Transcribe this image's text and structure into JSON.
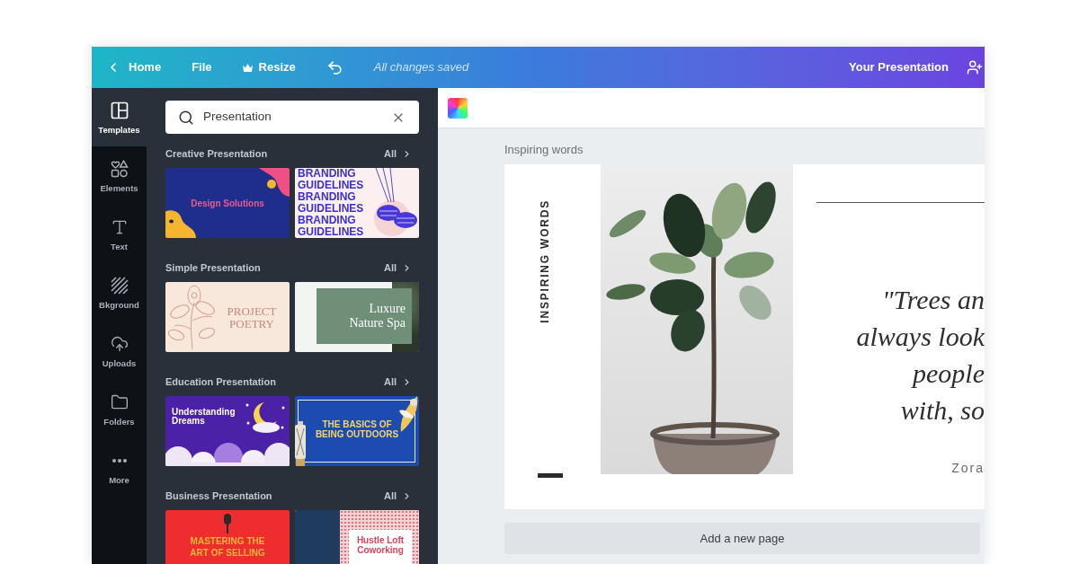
{
  "top_bar": {
    "items": [
      {
        "kind": "back",
        "label": "Home"
      },
      {
        "kind": "menu",
        "label": "File"
      },
      {
        "kind": "premium",
        "label": "Resize"
      },
      {
        "kind": "undo"
      }
    ],
    "status": "All changes saved",
    "title": "Your Presentation"
  },
  "side_rail": [
    {
      "kind": "templates",
      "label": "Templates",
      "selected": true
    },
    {
      "kind": "elements",
      "label": "Elements",
      "selected": false
    },
    {
      "kind": "text",
      "label": "Text",
      "selected": false
    },
    {
      "kind": "background",
      "label": "Bkground",
      "selected": false
    },
    {
      "kind": "uploads",
      "label": "Uploads",
      "selected": false
    },
    {
      "kind": "folders",
      "label": "Folders",
      "selected": false
    },
    {
      "kind": "more",
      "label": "More",
      "selected": false
    }
  ],
  "panel": {
    "search": {
      "value": "Presentation"
    },
    "sections": [
      {
        "title": "Creative Presentation",
        "link": "All",
        "templates": [
          {
            "kind": "blobs",
            "title": "Design Solutions"
          },
          {
            "kind": "type-stack",
            "title": "BRANDING GUIDELINES BRANDING GUIDELINES BRANDING GUIDELINES"
          }
        ]
      },
      {
        "title": "Simple Presentation",
        "link": "All",
        "templates": [
          {
            "kind": "floral",
            "title": "PROJECT POETRY"
          },
          {
            "kind": "green-panel",
            "title": "Luxure Nature Spa"
          }
        ]
      },
      {
        "title": "Education Presentation",
        "link": "All",
        "templates": [
          {
            "kind": "night-sky",
            "title": "Understanding Dreams"
          },
          {
            "kind": "framed",
            "title": "THE BASICS OF BEING OUTDOORS"
          }
        ]
      },
      {
        "title": "Business Presentation",
        "link": "All",
        "templates": [
          {
            "kind": "microphone",
            "title": "MASTERING THE ART OF SELLING"
          },
          {
            "kind": "dotted",
            "title": "Hustle Loft Coworking"
          }
        ]
      }
    ]
  },
  "editor": {
    "page_title": "Inspiring words",
    "page": {
      "side_title": "INSPIRING WORDS",
      "quote_lines": [
        "\"Trees an",
        "always look",
        "people",
        "with, so"
      ],
      "author": "Zora"
    },
    "add_page": "Add a new page"
  }
}
